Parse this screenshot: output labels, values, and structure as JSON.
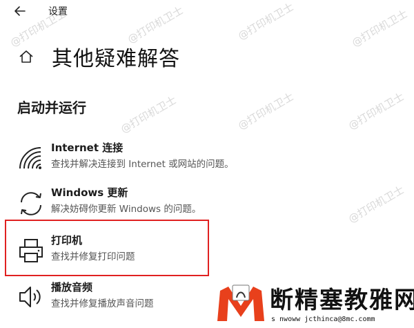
{
  "window": {
    "title": "设置"
  },
  "header": {
    "title": "其他疑难解答"
  },
  "section": {
    "title": "启动并运行"
  },
  "items": [
    {
      "name": "Internet 连接",
      "description": "查找并解决连接到 Internet 或网站的问题。",
      "icon": "wifi-icon"
    },
    {
      "name": "Windows 更新",
      "description": "解决妨碍你更新 Windows 的问题。",
      "icon": "sync-icon"
    },
    {
      "name": "打印机",
      "description": "查找并修复打印问题",
      "icon": "printer-icon"
    },
    {
      "name": "播放音频",
      "description": "查找并修复播放声音问题",
      "icon": "speaker-icon"
    }
  ],
  "highlight": {
    "color": "#e02020",
    "target": "打印机"
  },
  "watermarks": [
    "@打印机卫士",
    "@打印机卫士",
    "@打印机卫士",
    "@打印机卫士",
    "@打印机卫士",
    "@打印机卫士",
    "@打印机卫士",
    "@打印机卫士"
  ],
  "logo": {
    "text": "断精塞教雅网",
    "url": "s  nwoww jcthinca@8mc.comm",
    "accent_color": "#e8401c"
  }
}
